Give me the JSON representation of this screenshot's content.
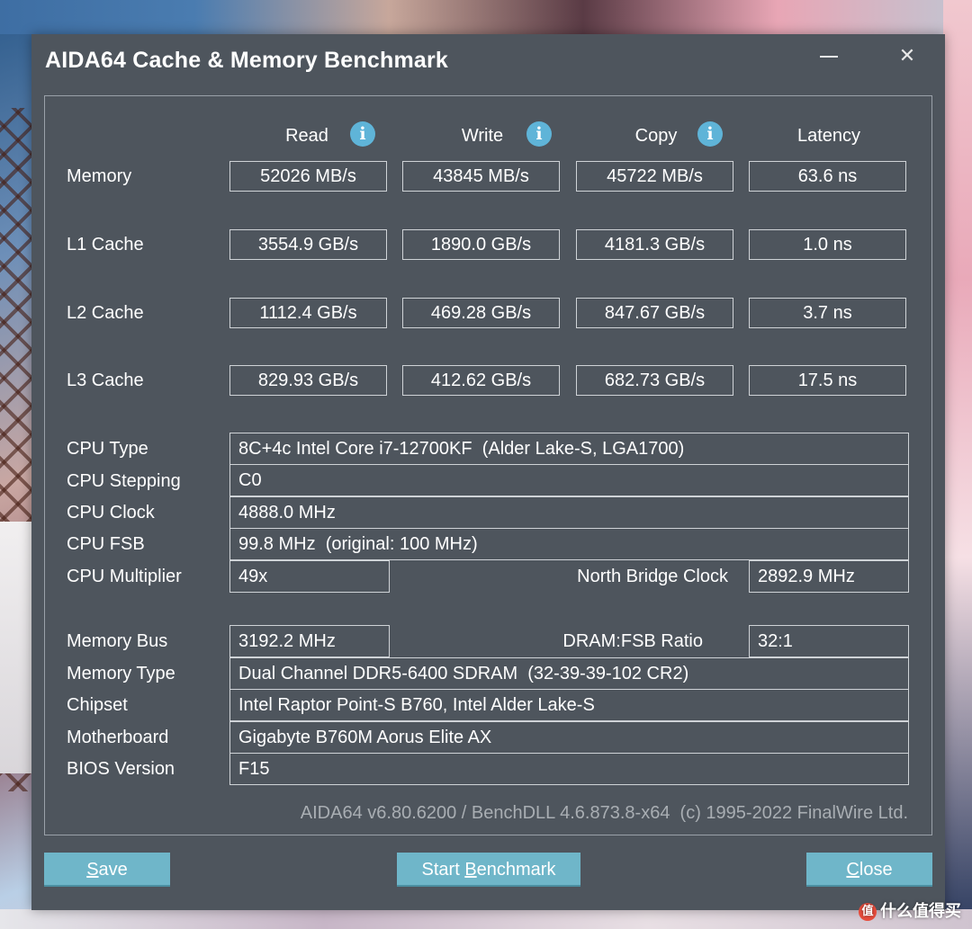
{
  "window": {
    "title": "AIDA64 Cache & Memory Benchmark",
    "minimize": "–",
    "close": "✕"
  },
  "columns": [
    "Read",
    "Write",
    "Copy",
    "Latency"
  ],
  "benchmark_rows": [
    {
      "label": "Memory",
      "read": "52026 MB/s",
      "write": "43845 MB/s",
      "copy": "45722 MB/s",
      "latency": "63.6 ns"
    },
    {
      "label": "L1 Cache",
      "read": "3554.9 GB/s",
      "write": "1890.0 GB/s",
      "copy": "4181.3 GB/s",
      "latency": "1.0 ns"
    },
    {
      "label": "L2 Cache",
      "read": "1112.4 GB/s",
      "write": "469.28 GB/s",
      "copy": "847.67 GB/s",
      "latency": "3.7 ns"
    },
    {
      "label": "L3 Cache",
      "read": "829.93 GB/s",
      "write": "412.62 GB/s",
      "copy": "682.73 GB/s",
      "latency": "17.5 ns"
    }
  ],
  "cpu": {
    "type_label": "CPU Type",
    "type_value": "8C+4c Intel Core i7-12700KF  (Alder Lake-S, LGA1700)",
    "stepping_label": "CPU Stepping",
    "stepping_value": "C0",
    "clock_label": "CPU Clock",
    "clock_value": "4888.0 MHz",
    "fsb_label": "CPU FSB",
    "fsb_value": "99.8 MHz  (original: 100 MHz)",
    "multiplier_label": "CPU Multiplier",
    "multiplier_value": "49x",
    "nb_clock_label": "North Bridge Clock",
    "nb_clock_value": "2892.9 MHz"
  },
  "memory": {
    "bus_label": "Memory Bus",
    "bus_value": "3192.2 MHz",
    "ratio_label": "DRAM:FSB Ratio",
    "ratio_value": "32:1",
    "type_label": "Memory Type",
    "type_value": "Dual Channel DDR5-6400 SDRAM  (32-39-39-102 CR2)",
    "chipset_label": "Chipset",
    "chipset_value": "Intel Raptor Point-S B760, Intel Alder Lake-S",
    "motherboard_label": "Motherboard",
    "motherboard_value": "Gigabyte B760M Aorus Elite AX",
    "bios_label": "BIOS Version",
    "bios_value": "F15"
  },
  "footer": "AIDA64 v6.80.6200 / BenchDLL 4.6.873.8-x64  (c) 1995-2022 FinalWire Ltd.",
  "buttons": {
    "save": {
      "accel": "S",
      "rest": "ave"
    },
    "start": {
      "pre": "Start ",
      "accel": "B",
      "rest": "enchmark"
    },
    "close": {
      "accel": "C",
      "rest": "lose"
    }
  },
  "watermark": {
    "icon": "值",
    "text": "什么值得买"
  },
  "colors": {
    "window_bg": "#4e555d",
    "button_bg": "#6fb6c9",
    "info_icon": "#5fb4d8",
    "footer_text": "#a9aeb3"
  }
}
